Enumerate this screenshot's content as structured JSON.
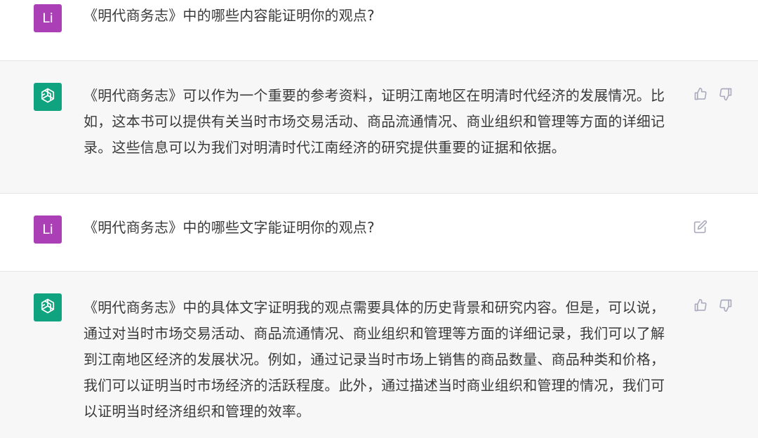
{
  "user_avatar_label": "Li",
  "colors": {
    "user_avatar": "#ab3fb5",
    "assistant_avatar": "#10a37f",
    "assistant_bg": "#f7f7f8",
    "icon": "#acacbe",
    "text": "#3a3a3a"
  },
  "messages": [
    {
      "role": "user",
      "text": "《明代商务志》中的哪些内容能证明你的观点?"
    },
    {
      "role": "assistant",
      "text": "《明代商务志》可以作为一个重要的参考资料，证明江南地区在明清时代经济的发展情况。比如，这本书可以提供有关当时市场交易活动、商品流通情况、商业组织和管理等方面的详细记录。这些信息可以为我们对明清时代江南经济的研究提供重要的证据和依据。",
      "actions": [
        "thumbs-up-icon",
        "thumbs-down-icon"
      ]
    },
    {
      "role": "user",
      "text": "《明代商务志》中的哪些文字能证明你的观点?",
      "actions": [
        "edit-icon"
      ]
    },
    {
      "role": "assistant",
      "text": "《明代商务志》中的具体文字证明我的观点需要具体的历史背景和研究内容。但是，可以说，通过对当时市场交易活动、商品流通情况、商业组织和管理等方面的详细记录，我们可以了解到江南地区经济的发展状况。例如，通过记录当时市场上销售的商品数量、商品种类和价格，我们可以证明当时市场经济的活跃程度。此外，通过描述当时商业组织和管理的情况，我们可以证明当时经济组织和管理的效率。",
      "actions": [
        "thumbs-up-icon",
        "thumbs-down-icon"
      ]
    }
  ]
}
